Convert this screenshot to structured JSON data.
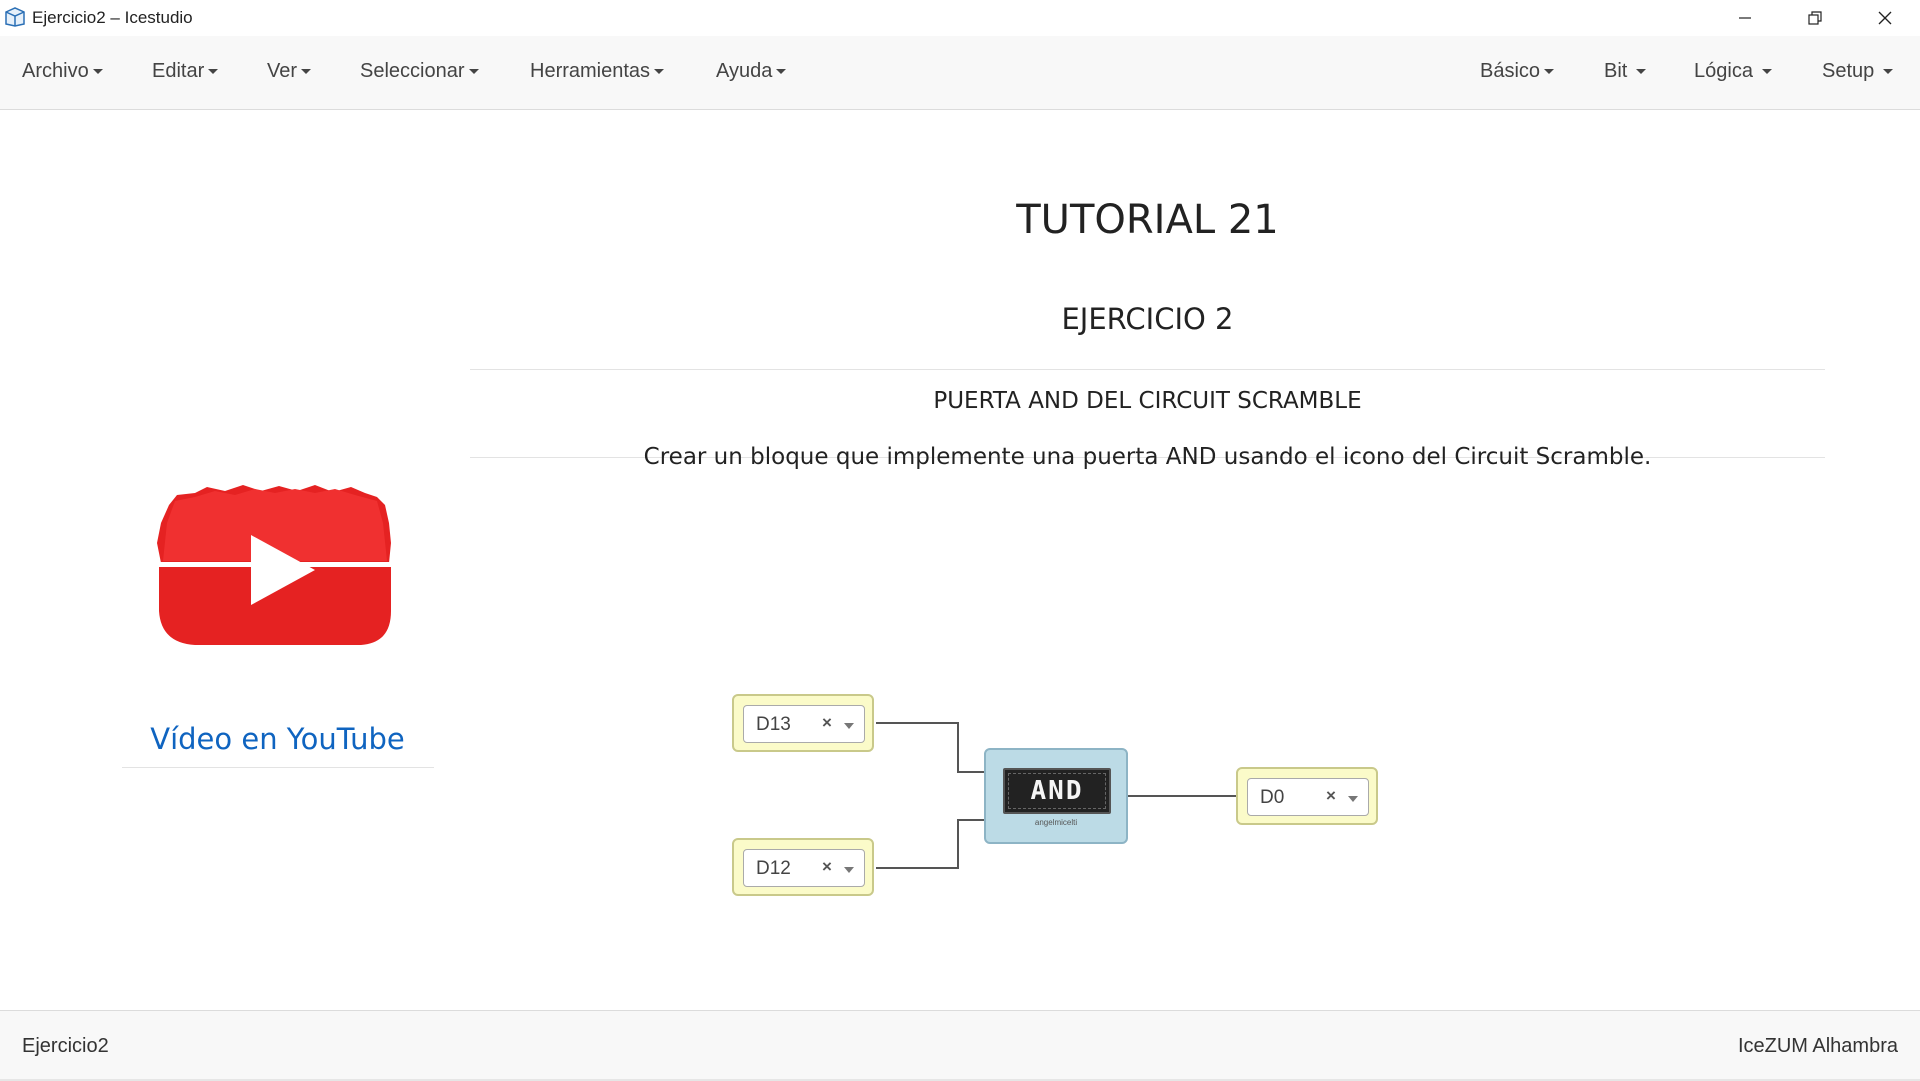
{
  "window": {
    "title": "Ejercicio2 – Icestudio"
  },
  "menu": {
    "left": [
      {
        "label": "Archivo"
      },
      {
        "label": "Editar"
      },
      {
        "label": "Ver"
      },
      {
        "label": "Seleccionar"
      },
      {
        "label": "Herramientas"
      },
      {
        "label": "Ayuda"
      }
    ],
    "right": [
      {
        "label": "Básico"
      },
      {
        "label": "Bit"
      },
      {
        "label": "Lógica"
      },
      {
        "label": "Setup"
      }
    ]
  },
  "content": {
    "tutorial_title": "TUTORIAL 21",
    "exercise_title": "EJERCICIO 2",
    "subtitle": "PUERTA AND DEL CIRCUIT SCRAMBLE",
    "description": "Crear un bloque que implemente una puerta AND usando el icono del Circuit Scramble.",
    "youtube_link": "Vídeo en YouTube"
  },
  "circuit": {
    "inputs": [
      {
        "pin": "D13",
        "clear": "×"
      },
      {
        "pin": "D12",
        "clear": "×"
      }
    ],
    "output": {
      "pin": "D0",
      "clear": "×"
    },
    "gate": {
      "label": "AND",
      "credit": "angelmicelti"
    }
  },
  "footer": {
    "project_name": "Ejercicio2",
    "board": "IceZUM Alhambra"
  },
  "colors": {
    "link": "#0f64c0",
    "pin_block": "#fbfbc9",
    "gate_block": "#bcdbe6",
    "youtube_red": "#e52222"
  }
}
